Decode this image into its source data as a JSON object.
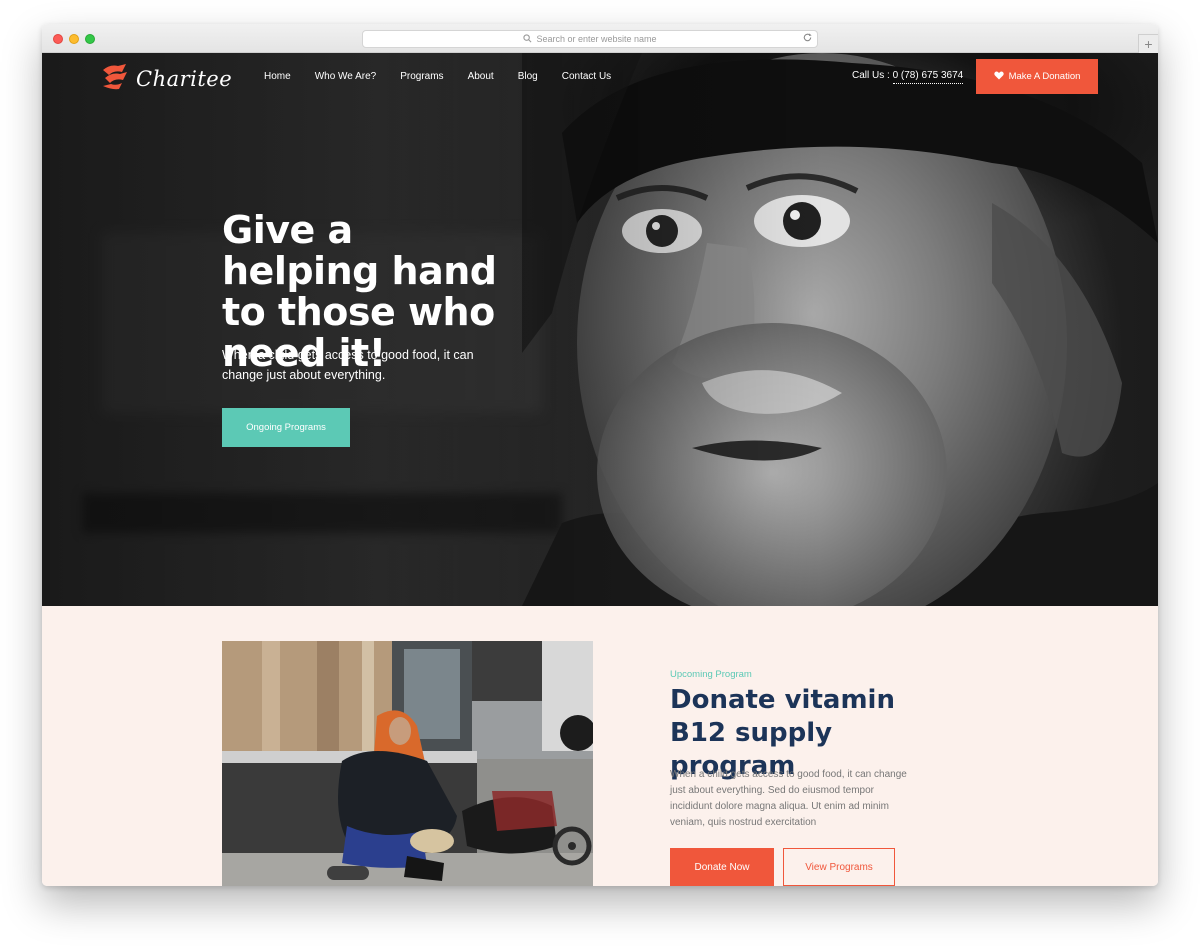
{
  "browser": {
    "url_placeholder": "Search or enter website name",
    "new_tab_label": "+"
  },
  "header": {
    "logo_text": "Charitee",
    "nav": [
      "Home",
      "Who We Are?",
      "Programs",
      "About",
      "Blog",
      "Contact Us"
    ],
    "call_label": "Call Us :",
    "call_number": "0 (78) 675 3674",
    "donate_label": "Make A Donation"
  },
  "hero": {
    "title": "Give a helping hand to those who need it!",
    "subtitle": "When a child gets access to good food, it can change just about everything.",
    "button": "Ongoing Programs"
  },
  "program": {
    "eyebrow": "Upcoming Program",
    "title": "Donate vitamin B12 supply program",
    "description": "When a child gets access to good food, it can change just about everything. Sed do eiusmod tempor incididunt dolore magna aliqua. Ut enim ad minim veniam, quis nostrud exercitation",
    "primary_button": "Donate Now",
    "secondary_button": "View Programs"
  },
  "colors": {
    "accent": "#f0573b",
    "teal": "#5cc9b5",
    "navy": "#1c3458",
    "section_bg": "#fcf1ec"
  },
  "icons": {
    "heart": "heart-icon",
    "search": "search-icon",
    "reload": "reload-icon",
    "logo": "charitee-logo-icon"
  }
}
